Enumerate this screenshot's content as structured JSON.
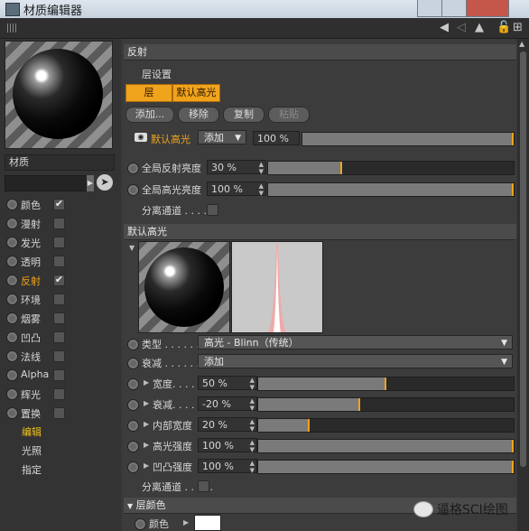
{
  "window": {
    "title": "材质编辑器"
  },
  "material": {
    "name": "材质"
  },
  "channels": [
    {
      "label": "颜色",
      "checked": "✔",
      "active": false
    },
    {
      "label": "漫射",
      "checked": "",
      "active": false
    },
    {
      "label": "发光",
      "checked": "",
      "active": false
    },
    {
      "label": "透明",
      "checked": "",
      "active": false
    },
    {
      "label": "反射",
      "checked": "✔",
      "active": true
    },
    {
      "label": "环境",
      "checked": "",
      "active": false
    },
    {
      "label": "烟雾",
      "checked": "",
      "active": false
    },
    {
      "label": "凹凸",
      "checked": "",
      "active": false
    },
    {
      "label": "法线",
      "checked": "",
      "active": false
    },
    {
      "label": "Alpha",
      "checked": "",
      "active": false
    },
    {
      "label": "辉光",
      "checked": "",
      "active": false
    },
    {
      "label": "置换",
      "checked": "",
      "active": false
    }
  ],
  "nav": [
    "编辑",
    "光照",
    "指定"
  ],
  "reflection": {
    "section_title": "反射",
    "layer_settings": "层设置",
    "tabs": [
      "层",
      "默认高光"
    ],
    "buttons": {
      "add": "添加...",
      "remove": "移除",
      "copy": "复制",
      "paste": "粘贴"
    },
    "layer_row": {
      "name": "默认高光",
      "mode": "添加",
      "value": "100 %",
      "fill": 1.0
    },
    "global_reflect": {
      "label": "全局反射亮度",
      "value": "30 %",
      "fill": 0.3
    },
    "global_spec": {
      "label": "全局高光亮度",
      "value": "100 %",
      "fill": 1.0
    },
    "separate": "分离通道 . . . . ."
  },
  "default_spec": {
    "section_title": "默认高光",
    "type_label": "类型 . . . . . .",
    "type_value": "高光 - Blinn（传统）",
    "falloff_label": "衰减 . . . . . .",
    "falloff_value": "添加",
    "params": [
      {
        "label": "宽度. . . .",
        "value": "50 %",
        "fill": 0.5
      },
      {
        "label": "衰减. . . .",
        "value": "-20 %",
        "fill": 0.4
      },
      {
        "label": "内部宽度",
        "value": "20 %",
        "fill": 0.2
      },
      {
        "label": "高光强度",
        "value": "100 %",
        "fill": 1.0
      },
      {
        "label": "凹凸强度",
        "value": "100 %",
        "fill": 1.0
      }
    ],
    "separate": "分离通道 . . . . ."
  },
  "layer_color": {
    "section_title": "层颜色",
    "color_label": "颜色"
  },
  "watermark": {
    "text": "逼格SCI绘图"
  },
  "colors": {
    "accent": "#f0a31c",
    "panel": "#3c3c3c",
    "header": "#4b4b4b"
  }
}
